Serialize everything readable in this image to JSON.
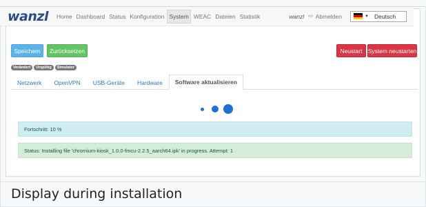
{
  "navbar": {
    "brand": "wanzl",
    "items": [
      "Home",
      "Dashboard",
      "Status",
      "Konfiguration",
      "System",
      "WEAC",
      "Dateien",
      "Statistik"
    ],
    "active_index": 4,
    "user": "wanzl",
    "logout": "Abmelden",
    "language": "Deutsch",
    "logout_icon": "sign-out-icon",
    "flag_icon": "german-flag-icon"
  },
  "toolbar": {
    "save": "Speichern",
    "reset": "Zurücksetzen",
    "restart": "Neustart",
    "system_restart": "System neustarten"
  },
  "badges": [
    "Verändert",
    "Ungültig",
    "Simulator"
  ],
  "tabs": [
    "Netzwerk",
    "OpenVPN",
    "USB-Geräte",
    "Hardware",
    "Software aktualisieren"
  ],
  "active_tab_index": 4,
  "progress": {
    "label": "Fortschritt: 10 %",
    "value_percent": 10
  },
  "status": {
    "text": "Status: Installing file 'chromium-kiosk_1.0.0-fmcu-2.2.5_aarch64.ipk' in progress. Attempt: 1"
  },
  "caption": "Display during installation",
  "colors": {
    "brand": "#2b4c88",
    "save": "#5cb3ec",
    "reset": "#62c462",
    "danger": "#dc3545",
    "spinner": "#1e6fd9",
    "info_bg": "#d1ecf1",
    "success_bg": "#d4edda"
  }
}
